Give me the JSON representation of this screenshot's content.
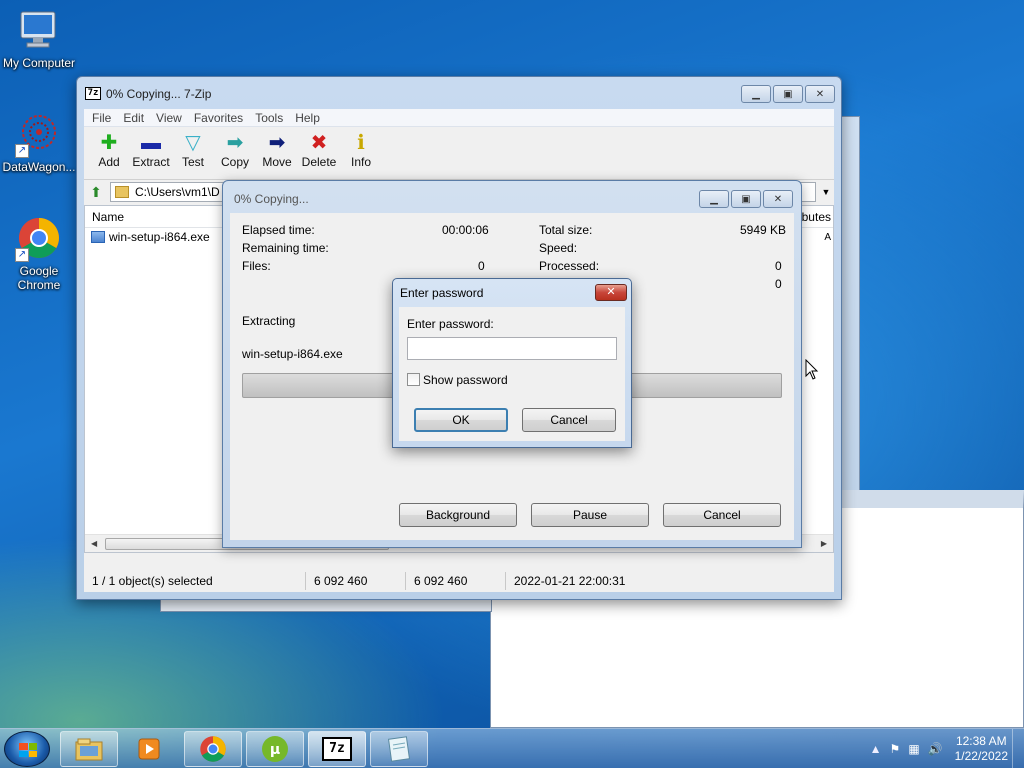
{
  "desktop": {
    "icons": [
      {
        "label": "My Computer"
      },
      {
        "label": "DataWagon..."
      },
      {
        "label": "Google Chrome"
      }
    ]
  },
  "window": {
    "title": "0% Copying... 7-Zip",
    "icon_text": "7z",
    "menu": [
      "File",
      "Edit",
      "View",
      "Favorites",
      "Tools",
      "Help"
    ],
    "toolbar": [
      {
        "label": "Add",
        "icon": "plus-icon",
        "color": "#1fae1f"
      },
      {
        "label": "Extract",
        "icon": "minus-icon",
        "color": "#1a2aa8"
      },
      {
        "label": "Test",
        "icon": "check-icon",
        "color": "#3ab0c8"
      },
      {
        "label": "Copy",
        "icon": "copy-arrow-icon",
        "color": "#2aa0a0"
      },
      {
        "label": "Move",
        "icon": "move-arrow-icon",
        "color": "#10207a"
      },
      {
        "label": "Delete",
        "icon": "delete-x-icon",
        "color": "#d02020"
      },
      {
        "label": "Info",
        "icon": "info-icon",
        "color": "#c8a800"
      }
    ],
    "address": "C:\\Users\\vm1\\D",
    "list": {
      "col_name": "Name",
      "col_attributes": "ributes",
      "attr_value": "A",
      "files": [
        {
          "name": "win-setup-i864.exe"
        }
      ]
    },
    "status": {
      "selected": "1 / 1 object(s) selected",
      "size": "6 092 460",
      "packed": "6 092 460",
      "modified": "2022-01-21 22:00:31"
    }
  },
  "progress": {
    "title": "0% Copying...",
    "elapsed_label": "Elapsed time:",
    "elapsed_value": "00:00:06",
    "remaining_label": "Remaining time:",
    "files_label": "Files:",
    "files_value": "0",
    "total_label": "Total size:",
    "total_value": "5949 KB",
    "speed_label": "Speed:",
    "processed_label": "Processed:",
    "processed_value": "0",
    "extra_value": "0",
    "operation": "Extracting",
    "current_file": "win-setup-i864.exe",
    "percent": 0,
    "buttons": {
      "background": "Background",
      "pause": "Pause",
      "cancel": "Cancel"
    }
  },
  "password_dialog": {
    "title": "Enter password",
    "prompt": "Enter password:",
    "value": "",
    "show_password_label": "Show password",
    "show_password_checked": false,
    "ok": "OK",
    "cancel": "Cancel"
  },
  "taskbar": {
    "apps": [
      "explorer-icon",
      "media-player-icon",
      "chrome-icon",
      "utorrent-icon",
      "7zip-icon",
      "notepad-icon"
    ],
    "app_7z_text": "7z",
    "clock_time": "12:38 AM",
    "clock_date": "1/22/2022"
  }
}
